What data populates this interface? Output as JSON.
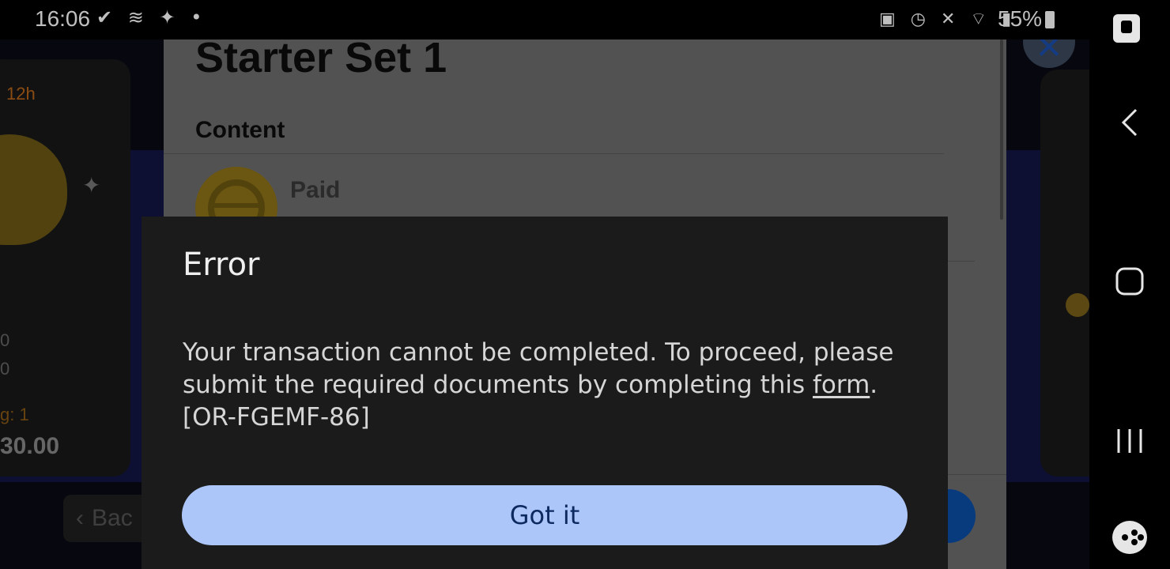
{
  "status_bar": {
    "time": "16:06",
    "left_icons": "✔ ≋ ✦ •",
    "right_icons": "▣ ◷ ✕ ⌔ ▮",
    "battery": "55%"
  },
  "background": {
    "left_card": {
      "timer": "12h",
      "value_1": "0",
      "value_2": "0",
      "rating": "g: 1",
      "price": "30.00"
    },
    "back_button_label": "Bac",
    "close_icon": "✕"
  },
  "product_sheet": {
    "title": "Starter Set 1",
    "content_heading": "Content",
    "item_label": "Paid"
  },
  "dialog": {
    "title": "Error",
    "message_part1": "Your transaction cannot be completed. To proceed, please submit the required documents by completing this ",
    "link_text": "form",
    "message_part2": ".",
    "error_code": "[OR-FGEMF-86]",
    "button_label": "Got it"
  },
  "nav_bar": {
    "back_icon": "back-chevron",
    "home_icon": "home-square",
    "recents_icon": "recents-lines"
  },
  "colors": {
    "dialog_bg": "#1b1b1b",
    "button_bg": "#adc6f9",
    "button_text": "#0d2a60"
  }
}
